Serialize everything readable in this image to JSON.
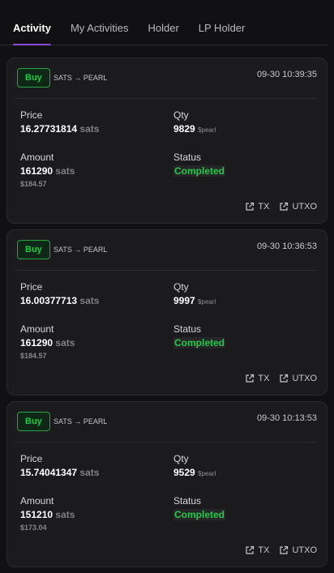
{
  "tabs": [
    {
      "label": "Activity",
      "active": true
    },
    {
      "label": "My Activities",
      "active": false
    },
    {
      "label": "Holder",
      "active": false
    },
    {
      "label": "LP Holder",
      "active": false
    }
  ],
  "labels": {
    "price": "Price",
    "qty": "Qty",
    "amount": "Amount",
    "status": "Status",
    "tx": "TX",
    "utxo": "UTXO"
  },
  "activities": [
    {
      "type": "Buy",
      "pair": "SATS → PEARL",
      "time": "09-30 10:39:35",
      "price": "16.27731814",
      "price_unit": "sats",
      "qty": "9829",
      "qty_unit": "$pearl",
      "amount": "161290",
      "amount_unit": "sats",
      "amount_usd": "$184.57",
      "status": "Completed"
    },
    {
      "type": "Buy",
      "pair": "SATS → PEARL",
      "time": "09-30 10:36:53",
      "price": "16.00377713",
      "price_unit": "sats",
      "qty": "9997",
      "qty_unit": "$pearl",
      "amount": "161290",
      "amount_unit": "sats",
      "amount_usd": "$184.57",
      "status": "Completed"
    },
    {
      "type": "Buy",
      "pair": "SATS → PEARL",
      "time": "09-30 10:13:53",
      "price": "15.74041347",
      "price_unit": "sats",
      "qty": "9529",
      "qty_unit": "$pearl",
      "amount": "151210",
      "amount_unit": "sats",
      "amount_usd": "$173.04",
      "status": "Completed"
    }
  ],
  "colors": {
    "accent": "#8a4bd8",
    "buy_green": "#27c94a",
    "card_bg": "#1b1b1e",
    "page_bg": "#111113"
  },
  "icons": {
    "link": "external-link-icon"
  }
}
